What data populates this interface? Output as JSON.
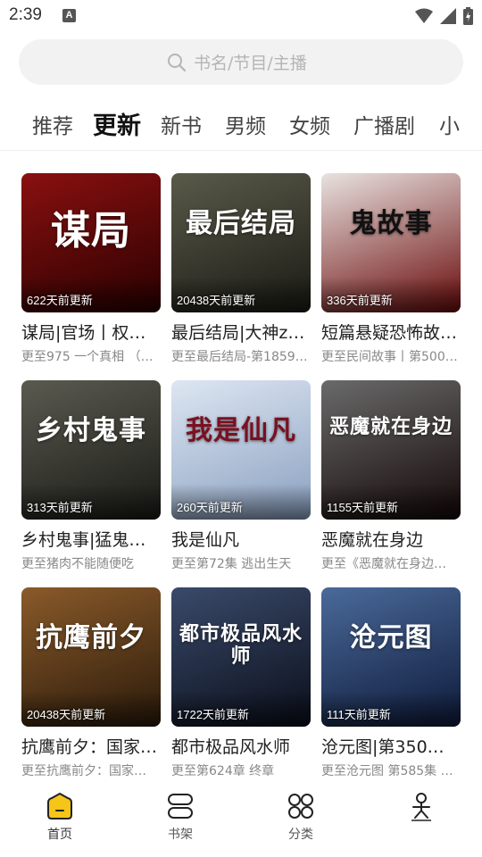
{
  "status": {
    "time": "2:39",
    "a_icon": "A"
  },
  "search": {
    "placeholder": "书名/节目/主播"
  },
  "tabs": [
    {
      "label": "推荐",
      "active": false
    },
    {
      "label": "更新",
      "active": true
    },
    {
      "label": "新书",
      "active": false
    },
    {
      "label": "男频",
      "active": false
    },
    {
      "label": "女频",
      "active": false
    },
    {
      "label": "广播剧",
      "active": false
    },
    {
      "label": "小",
      "active": false
    }
  ],
  "cards": [
    {
      "cover_text": "谋局",
      "badge": "622天前更新",
      "title": "谋局|官场丨权…",
      "subtitle": "更至975 一个真相 （…",
      "bg1": "#8a1010",
      "bg2": "#2a0000",
      "fg": "#ffffff"
    },
    {
      "cover_text": "最后结局",
      "badge": "20438天前更新",
      "title": "最后结局|大神z…",
      "subtitle": "更至最后结局-第1859…",
      "bg1": "#5a5a4a",
      "bg2": "#1a1a14",
      "fg": "#ffffff"
    },
    {
      "cover_text": "鬼故事",
      "badge": "336天前更新",
      "title": "短篇悬疑恐怖故…",
      "subtitle": "更至民间故事丨第500…",
      "bg1": "#e8e2e0",
      "bg2": "#6a0a0a",
      "fg": "#111111"
    },
    {
      "cover_text": "乡村鬼事",
      "badge": "313天前更新",
      "title": "乡村鬼事|猛鬼…",
      "subtitle": "更至猪肉不能随便吃",
      "bg1": "#5a5a50",
      "bg2": "#1a1a16",
      "fg": "#ffffff"
    },
    {
      "cover_text": "我是仙凡",
      "badge": "260天前更新",
      "title": "我是仙凡",
      "subtitle": "更至第72集 逃出生天",
      "bg1": "#dde6f2",
      "bg2": "#8aa0c0",
      "fg": "#7a1020"
    },
    {
      "cover_text": "恶魔就在身边",
      "badge": "1155天前更新",
      "title": "恶魔就在身边",
      "subtitle": "更至《恶魔就在身边…",
      "bg1": "#6a6a6a",
      "bg2": "#140808",
      "fg": "#ffffff"
    },
    {
      "cover_text": "抗鹰前夕",
      "badge": "20438天前更新",
      "title": "抗鹰前夕：国家…",
      "subtitle": "更至抗鹰前夕：国家…",
      "bg1": "#8a5a2a",
      "bg2": "#2a1a0a",
      "fg": "#ffffff"
    },
    {
      "cover_text": "都市极品风水师",
      "badge": "1722天前更新",
      "title": "都市极品风水师",
      "subtitle": "更至第624章  终章",
      "bg1": "#3a4a6a",
      "bg2": "#0a0e1a",
      "fg": "#ffffff"
    },
    {
      "cover_text": "沧元图",
      "badge": "111天前更新",
      "title": "沧元图|第350集…",
      "subtitle": "更至沧元图 第585集 …",
      "bg1": "#4a6a9a",
      "bg2": "#0e1a3a",
      "fg": "#ffffff"
    }
  ],
  "nav": [
    {
      "label": "首页",
      "active": true
    },
    {
      "label": "书架",
      "active": false
    },
    {
      "label": "分类",
      "active": false
    },
    {
      "label": "",
      "active": false
    }
  ],
  "colors": {
    "accent": "#f5c518",
    "text": "#222222",
    "muted": "#888888"
  }
}
